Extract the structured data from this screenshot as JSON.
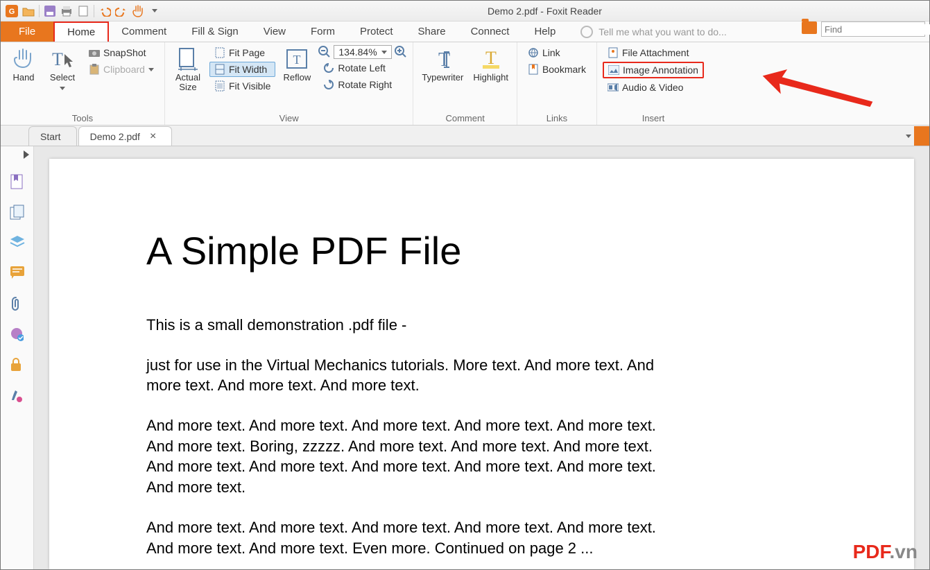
{
  "app_title": "Demo 2.pdf - Foxit Reader",
  "menu": {
    "file": "File",
    "tabs": [
      "Home",
      "Comment",
      "Fill & Sign",
      "View",
      "Form",
      "Protect",
      "Share",
      "Connect",
      "Help"
    ],
    "tell_me": "Tell me what you want to do...",
    "find_placeholder": "Find"
  },
  "ribbon": {
    "tools": {
      "hand": "Hand",
      "select": "Select",
      "snapshot": "SnapShot",
      "clipboard": "Clipboard",
      "label": "Tools"
    },
    "view": {
      "actual_size": "Actual\nSize",
      "fit_page": "Fit Page",
      "fit_width": "Fit Width",
      "fit_visible": "Fit Visible",
      "reflow": "Reflow",
      "zoom_value": "134.84%",
      "rotate_left": "Rotate Left",
      "rotate_right": "Rotate Right",
      "label": "View"
    },
    "comment": {
      "typewriter": "Typewriter",
      "highlight": "Highlight",
      "label": "Comment"
    },
    "links": {
      "link": "Link",
      "bookmark": "Bookmark",
      "label": "Links"
    },
    "insert": {
      "file_attachment": "File Attachment",
      "image_annotation": "Image Annotation",
      "audio_video": "Audio & Video",
      "label": "Insert"
    }
  },
  "doctabs": {
    "start": "Start",
    "demo": "Demo 2.pdf"
  },
  "document": {
    "title": "A Simple PDF File",
    "p1": "This is a small demonstration .pdf file -",
    "p2": "just for use in the Virtual Mechanics tutorials. More text. And more text. And more text. And more text. And more text.",
    "p3": "And more text. And more text. And more text. And more text. And more text. And more text. Boring, zzzzz. And more text. And more text. And more text. And more text. And more text. And more text. And more text. And more text. And more text.",
    "p4": "And more text. And more text. And more text. And more text. And more text. And more text. And more text. Even more. Continued on page 2 ..."
  },
  "watermark": {
    "a": "PDF",
    "b": ".vn"
  }
}
